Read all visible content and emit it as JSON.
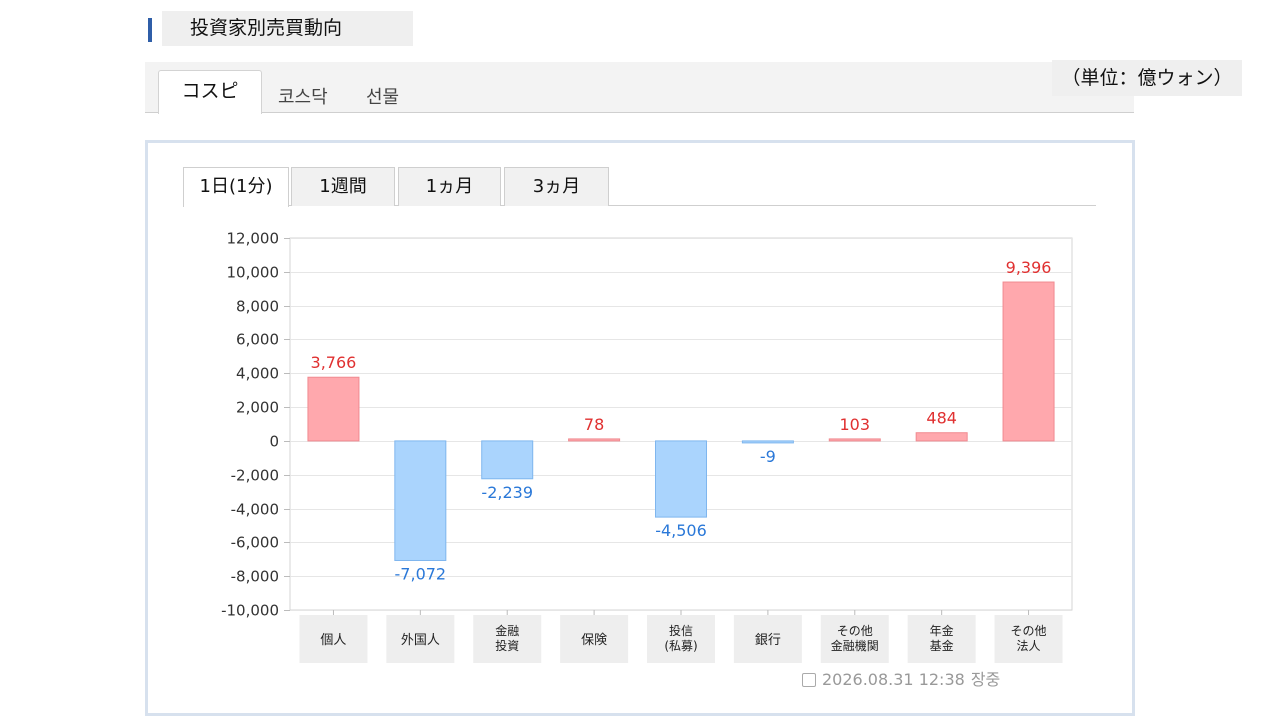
{
  "header": {
    "title": "投資家別売買動向"
  },
  "market_tabs": [
    "コスピ",
    "코스닥",
    "선물"
  ],
  "unit_label": "（単位：億ウォン）",
  "period_tabs": [
    "1日(1分)",
    "1週間",
    "1ヵ月",
    "3ヵ月"
  ],
  "timestamp": "2026.08.31 12:38",
  "status": "장중",
  "colors": {
    "positive_fill": "#ffa8ad",
    "positive_stroke": "#f08a90",
    "positive_text": "#e03030",
    "negative_fill": "#aad4fd",
    "negative_stroke": "#7fb6ee",
    "negative_text": "#2a78d8"
  },
  "chart_data": {
    "type": "bar",
    "categories": [
      [
        "個人"
      ],
      [
        "外国人"
      ],
      [
        "金融",
        "投資"
      ],
      [
        "保険"
      ],
      [
        "投信",
        "(私募)"
      ],
      [
        "銀行"
      ],
      [
        "その他",
        "金融機関"
      ],
      [
        "年金",
        "基金"
      ],
      [
        "その他",
        "法人"
      ]
    ],
    "values": [
      3766,
      -7072,
      -2239,
      78,
      -4506,
      -9,
      103,
      484,
      9396
    ],
    "value_labels": [
      "3,766",
      "-7,072",
      "-2,239",
      "78",
      "-4,506",
      "-9",
      "103",
      "484",
      "9,396"
    ],
    "ylim": [
      -10000,
      12000
    ],
    "yticks": [
      12000,
      10000,
      8000,
      6000,
      4000,
      2000,
      0,
      -2000,
      -4000,
      -6000,
      -8000,
      -10000
    ],
    "ytick_labels": [
      "12,000",
      "10,000",
      "8,000",
      "6,000",
      "4,000",
      "2,000",
      "0",
      "-2,000",
      "-4,000",
      "-6,000",
      "-8,000",
      "-10,000"
    ],
    "grid": true
  }
}
